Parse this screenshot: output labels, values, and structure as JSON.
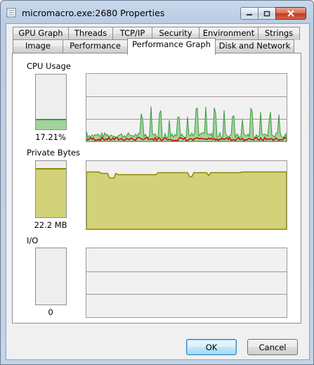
{
  "window": {
    "title": "micromacro.exe:2680 Properties"
  },
  "tabs_row1": [
    {
      "label": "GPU Graph"
    },
    {
      "label": "Threads"
    },
    {
      "label": "TCP/IP"
    },
    {
      "label": "Security"
    },
    {
      "label": "Environment"
    },
    {
      "label": "Strings"
    }
  ],
  "tabs_row2": [
    {
      "label": "Image"
    },
    {
      "label": "Performance"
    },
    {
      "label": "Performance Graph",
      "active": true
    },
    {
      "label": "Disk and Network"
    }
  ],
  "cpu": {
    "label": "CPU Usage",
    "value": "17.21%",
    "level": 0.1721,
    "kernel_color": "#e00000",
    "color": "#3c9b3c",
    "fill_color": "#a2d39c"
  },
  "private_bytes": {
    "label": "Private Bytes",
    "value": "22.2 MB",
    "level": 0.85,
    "color": "#8c8a00",
    "fill_color": "#d2d27a"
  },
  "io": {
    "label": "I/O",
    "value": "0",
    "level": 0
  },
  "buttons": {
    "ok": "OK",
    "cancel": "Cancel"
  }
}
